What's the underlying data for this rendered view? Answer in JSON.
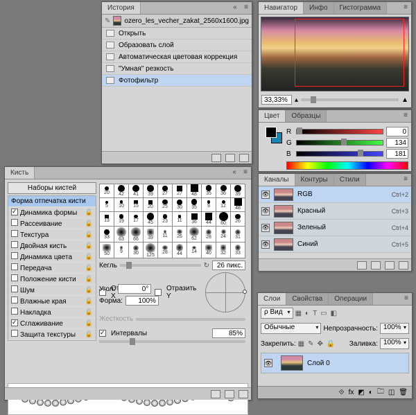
{
  "history": {
    "tab": "История",
    "filename": "ozero_les_vecher_zakat_2560x1600.jpg",
    "items": [
      {
        "label": "Открыть"
      },
      {
        "label": "Образовать слой"
      },
      {
        "label": "Автоматическая цветовая коррекция"
      },
      {
        "label": "\"Умная\" резкость"
      },
      {
        "label": "Фотофильтр"
      }
    ]
  },
  "brush": {
    "tab": "Кисть",
    "presets_btn": "Наборы кистей",
    "section": "Форма отпечатка кисти",
    "options": [
      {
        "label": "Динамика формы",
        "checked": true,
        "lock": true
      },
      {
        "label": "Рассеивание",
        "checked": false,
        "lock": true
      },
      {
        "label": "Текстура",
        "checked": false,
        "lock": true
      },
      {
        "label": "Двойная кисть",
        "checked": false,
        "lock": true
      },
      {
        "label": "Динамика цвета",
        "checked": false,
        "lock": true
      },
      {
        "label": "Передача",
        "checked": false,
        "lock": true
      },
      {
        "label": "Положение кисти",
        "checked": false,
        "lock": true
      },
      {
        "label": "Шум",
        "checked": false,
        "lock": true
      },
      {
        "label": "Влажные края",
        "checked": false,
        "lock": true
      },
      {
        "label": "Накладка",
        "checked": false,
        "lock": true
      },
      {
        "label": "Сглаживание",
        "checked": true,
        "lock": true
      },
      {
        "label": "Защита текстуры",
        "checked": false,
        "lock": true
      }
    ],
    "size_label": "Кегль",
    "size_value": "26 пикс.",
    "flipx": "Отразить X",
    "flipy": "Отразить Y",
    "angle_label": "Угол:",
    "angle_value": "0°",
    "round_label": "Форма:",
    "round_value": "100%",
    "hardness": "Жесткость",
    "spacing_label": "Интервалы",
    "spacing_value": "85%",
    "grid_sizes": [
      "20",
      "42",
      "41",
      "39",
      "27",
      "27",
      "48",
      "35",
      "36",
      "39",
      "5",
      "10",
      "15",
      "20",
      "25",
      "30",
      "35",
      "9",
      "12",
      "48",
      "13",
      "19",
      "17",
      "45",
      "23",
      "11",
      "36",
      "44",
      "60",
      "26",
      "33",
      "63",
      "66",
      "39",
      "11",
      "26",
      "62",
      "28",
      "24",
      "31",
      "50",
      "9",
      "30",
      "125",
      "28",
      "44",
      "14",
      "40",
      "32",
      "33"
    ]
  },
  "nav": {
    "tabs": [
      "Навигатор",
      "Инфо",
      "Гистограмма"
    ],
    "zoom": "33,33%"
  },
  "color": {
    "tabs": [
      "Цвет",
      "Образцы"
    ],
    "r": {
      "label": "R",
      "value": "0"
    },
    "g": {
      "label": "G",
      "value": "134"
    },
    "b": {
      "label": "B",
      "value": "181"
    }
  },
  "channels": {
    "tabs": [
      "Каналы",
      "Контуры",
      "Стили"
    ],
    "rows": [
      {
        "label": "RGB",
        "shortcut": "Ctrl+2"
      },
      {
        "label": "Красный",
        "shortcut": "Ctrl+3"
      },
      {
        "label": "Зеленый",
        "shortcut": "Ctrl+4"
      },
      {
        "label": "Синий",
        "shortcut": "Ctrl+5"
      }
    ]
  },
  "layers": {
    "tabs": [
      "Слои",
      "Свойства",
      "Операции"
    ],
    "kind_label": "ρ Вид",
    "blend": "Обычные",
    "opacity_label": "Непрозрачность:",
    "opacity": "100%",
    "lock_label": "Закрепить:",
    "fill_label": "Заливка:",
    "fill": "100%",
    "layer0": "Слой 0"
  }
}
